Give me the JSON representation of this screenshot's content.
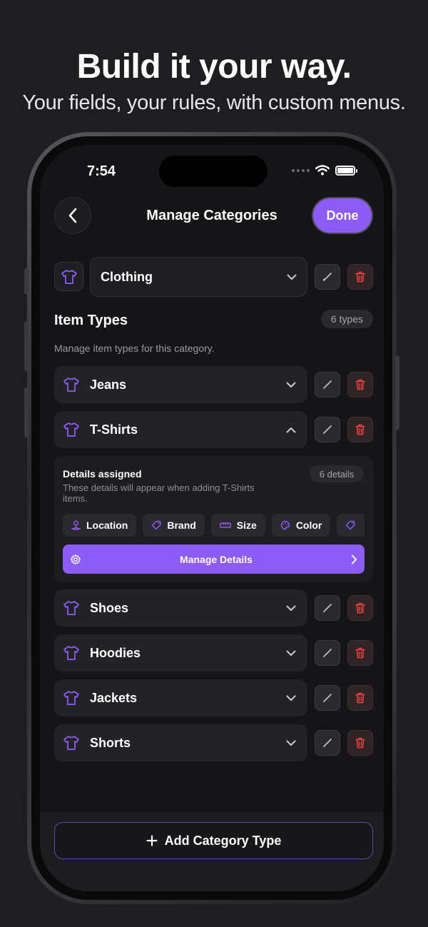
{
  "promo": {
    "headline": "Build it your way.",
    "subline": "Your fields, your rules, with custom menus."
  },
  "status_bar": {
    "time": "7:54"
  },
  "nav": {
    "title": "Manage Categories",
    "done_label": "Done"
  },
  "category": {
    "selected": "Clothing"
  },
  "item_types": {
    "title": "Item Types",
    "count_label": "6 types",
    "subtitle": "Manage item types for this category.",
    "rows": [
      {
        "label": "Jeans",
        "expanded": false
      },
      {
        "label": "T-Shirts",
        "expanded": true
      },
      {
        "label": "Shoes",
        "expanded": false
      },
      {
        "label": "Hoodies",
        "expanded": false
      },
      {
        "label": "Jackets",
        "expanded": false
      },
      {
        "label": "Shorts",
        "expanded": false
      }
    ]
  },
  "details": {
    "title": "Details assigned",
    "description": "These details will appear when adding T-Shirts items.",
    "count_label": "6 details",
    "chips": [
      {
        "label": "Location",
        "icon": "pin-icon"
      },
      {
        "label": "Brand",
        "icon": "tag-icon"
      },
      {
        "label": "Size",
        "icon": "ruler-icon"
      },
      {
        "label": "Color",
        "icon": "palette-icon"
      },
      {
        "label": "",
        "icon": "tag-icon"
      }
    ],
    "manage_label": "Manage Details"
  },
  "footer": {
    "add_label": "Add Category Type"
  },
  "colors": {
    "accent": "#8b5cf6",
    "delete": "#ef4444",
    "background": "#151517"
  }
}
